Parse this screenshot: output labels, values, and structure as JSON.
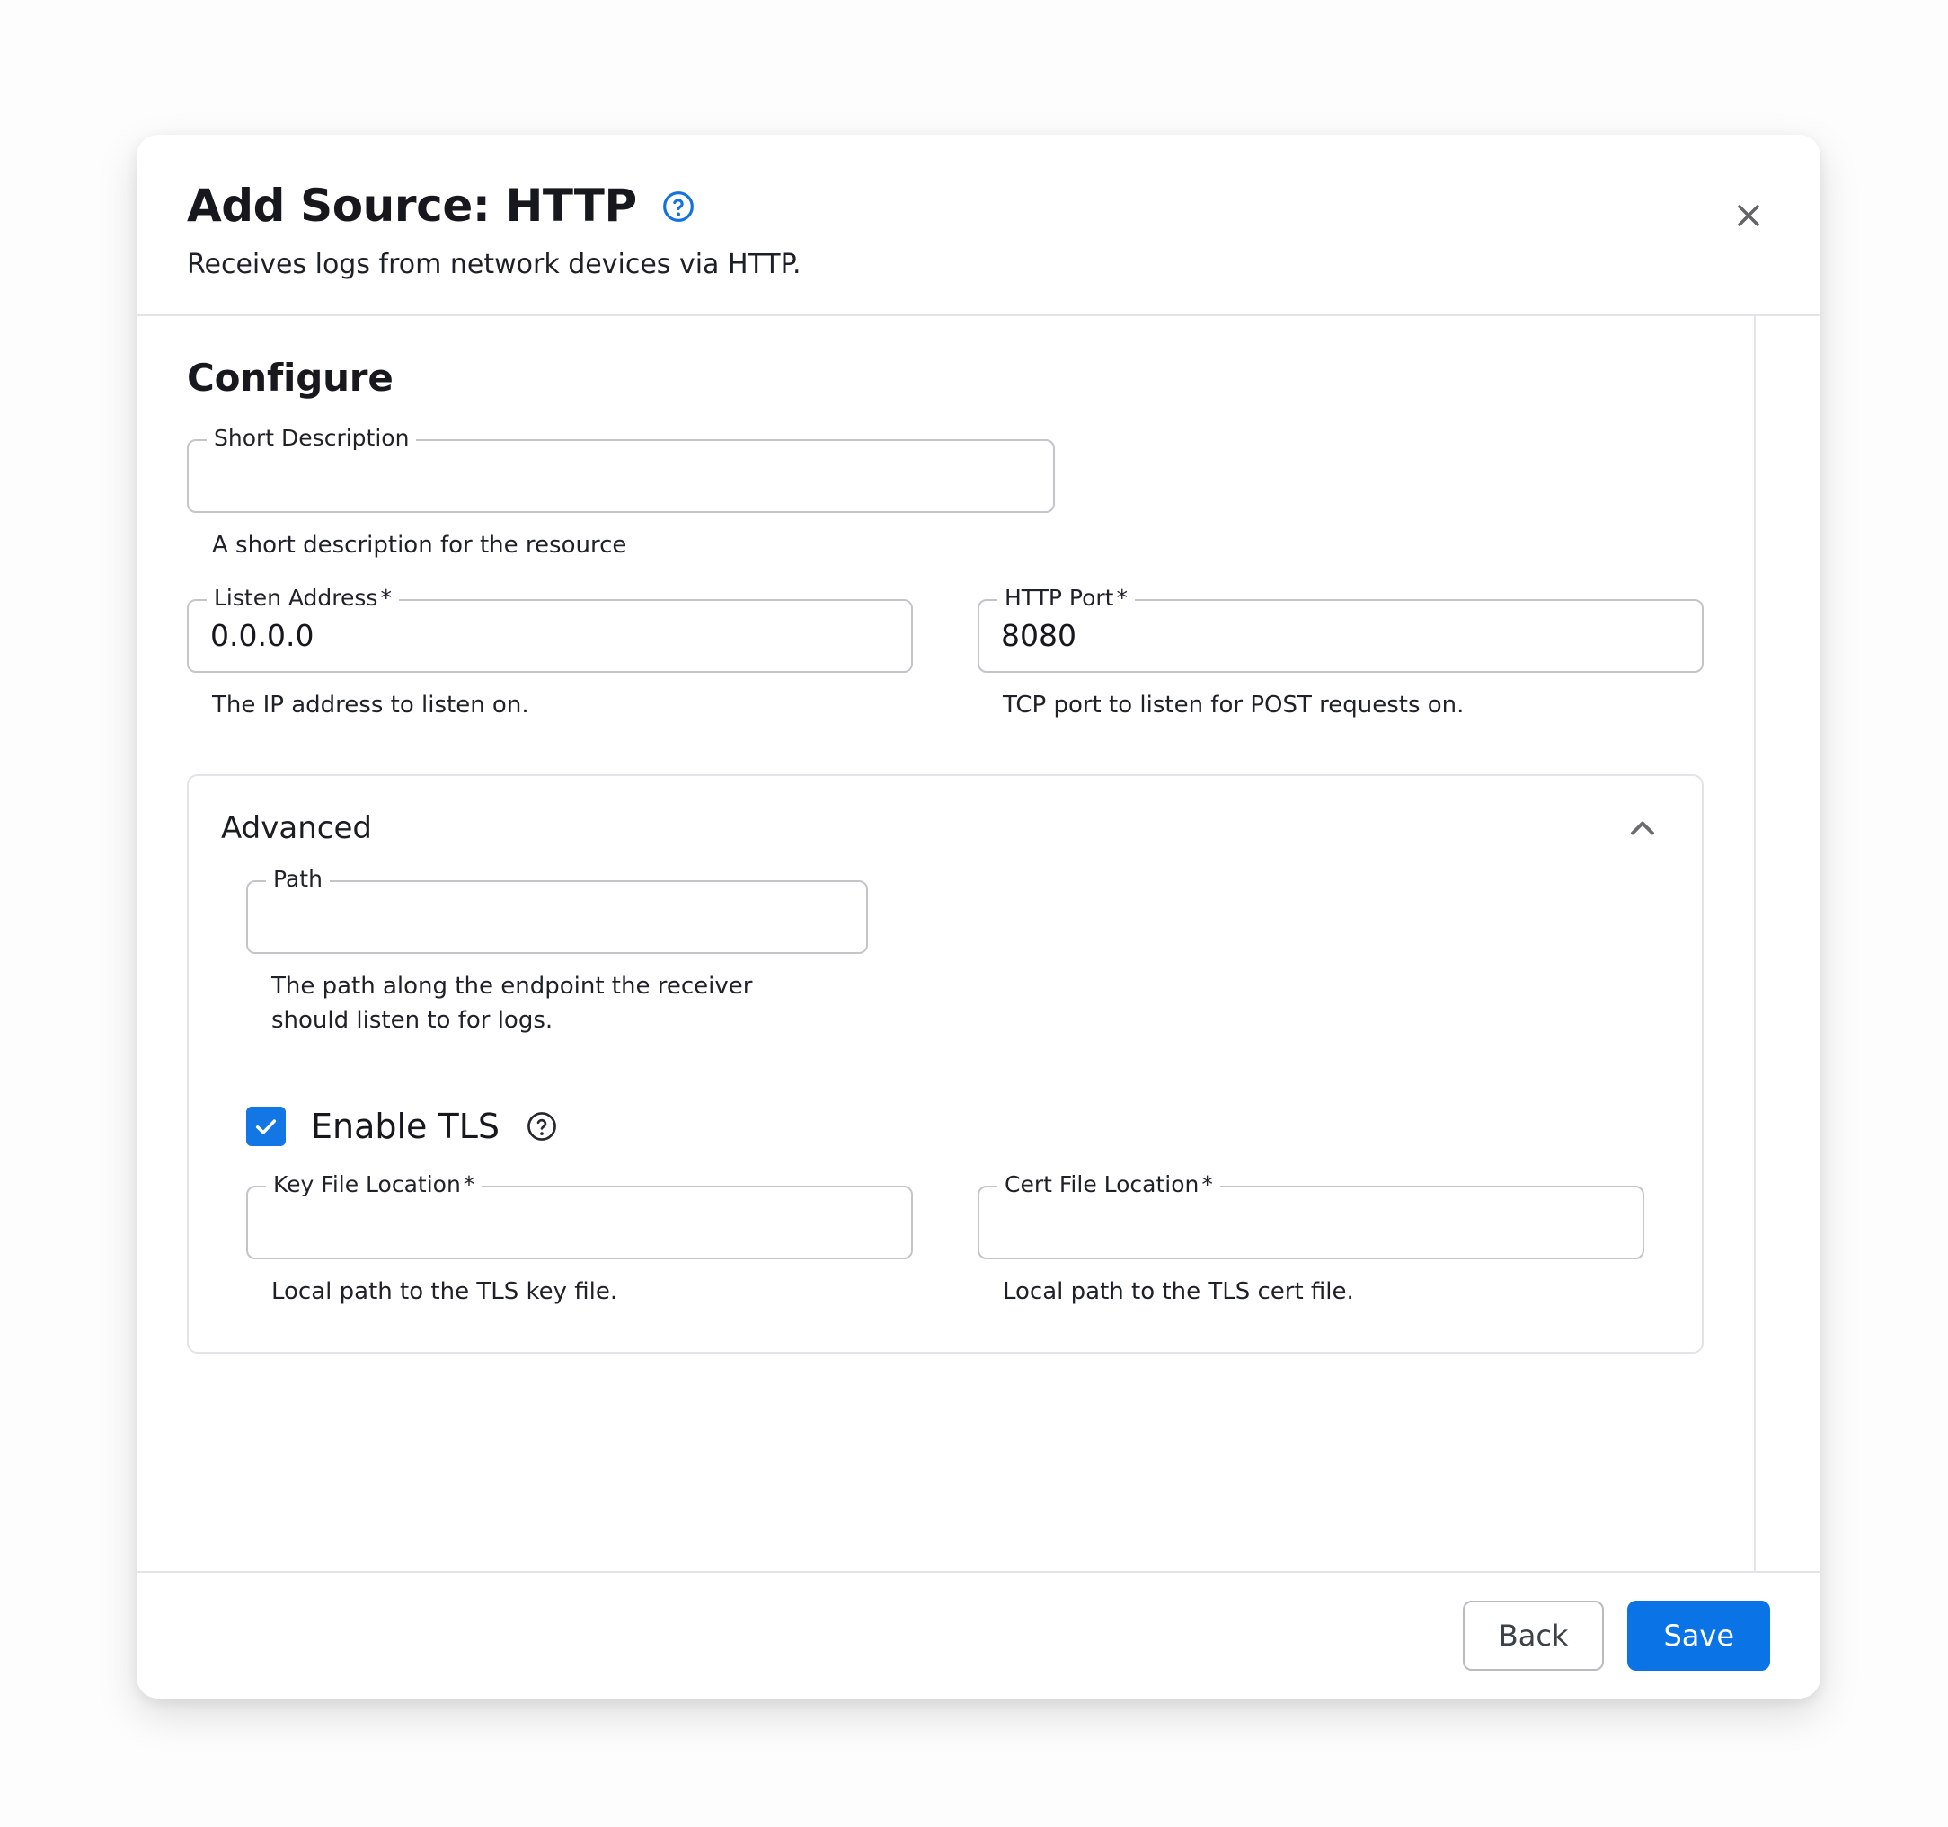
{
  "dialog": {
    "title": "Add Source: HTTP",
    "title_help_icon": "help-circle-icon",
    "subtitle": "Receives logs from network devices via HTTP.",
    "close_icon": "close-icon",
    "accent_color": "#0a74e6",
    "title_help_color": "#1273e0",
    "border_color": "#c4c5c8"
  },
  "configure": {
    "section_title": "Configure",
    "short_description": {
      "label": "Short Description",
      "value": "",
      "placeholder": "",
      "helper": "A short description for the resource",
      "required": false
    },
    "listen_address": {
      "label": "Listen Address",
      "required_marker": "*",
      "value": "0.0.0.0",
      "helper": "The IP address to listen on.",
      "required": true
    },
    "http_port": {
      "label": "HTTP Port",
      "required_marker": "*",
      "value": "8080",
      "helper": "TCP port to listen for POST requests on.",
      "required": true
    }
  },
  "advanced": {
    "label": "Advanced",
    "expanded": true,
    "collapse_icon": "chevron-up-icon",
    "path": {
      "label": "Path",
      "value": "",
      "placeholder": "",
      "helper": "The path along the endpoint the receiver should listen to for logs.",
      "required": false
    },
    "enable_tls": {
      "label": "Enable TLS",
      "checked": true,
      "check_icon": "checkmark-icon",
      "help_icon": "help-circle-icon",
      "checkbox_color": "#1277e5"
    },
    "key_file_location": {
      "label": "Key File Location",
      "required_marker": "*",
      "value": "",
      "helper": "Local path to the TLS key file.",
      "required": true
    },
    "cert_file_location": {
      "label": "Cert File Location",
      "required_marker": "*",
      "value": "",
      "helper": "Local path to the TLS cert file.",
      "required": true
    }
  },
  "footer": {
    "back_label": "Back",
    "save_label": "Save"
  }
}
